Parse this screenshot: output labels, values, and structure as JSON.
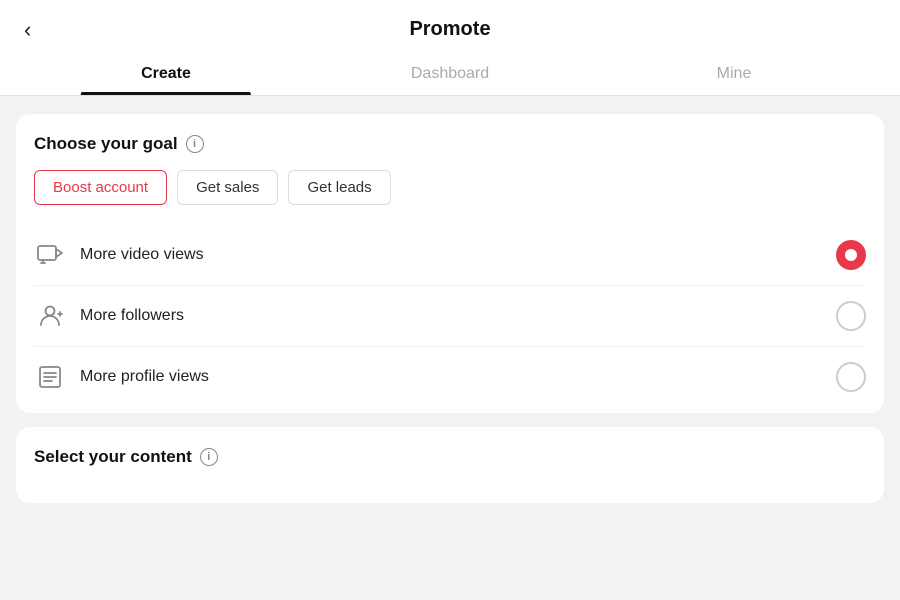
{
  "header": {
    "title": "Promote",
    "back_label": "‹"
  },
  "tabs": [
    {
      "id": "create",
      "label": "Create",
      "active": true
    },
    {
      "id": "dashboard",
      "label": "Dashboard",
      "active": false
    },
    {
      "id": "mine",
      "label": "Mine",
      "active": false
    }
  ],
  "goal_card": {
    "title": "Choose your goal",
    "info_label": "i",
    "goal_buttons": [
      {
        "id": "boost-account",
        "label": "Boost account",
        "active": true
      },
      {
        "id": "get-sales",
        "label": "Get sales",
        "active": false
      },
      {
        "id": "get-leads",
        "label": "Get leads",
        "active": false
      }
    ],
    "options": [
      {
        "id": "video-views",
        "label": "More video views",
        "icon": "video",
        "selected": true
      },
      {
        "id": "followers",
        "label": "More followers",
        "icon": "person",
        "selected": false
      },
      {
        "id": "profile-views",
        "label": "More profile views",
        "icon": "list",
        "selected": false
      }
    ]
  },
  "content_card": {
    "title": "Select your content",
    "info_label": "i"
  }
}
